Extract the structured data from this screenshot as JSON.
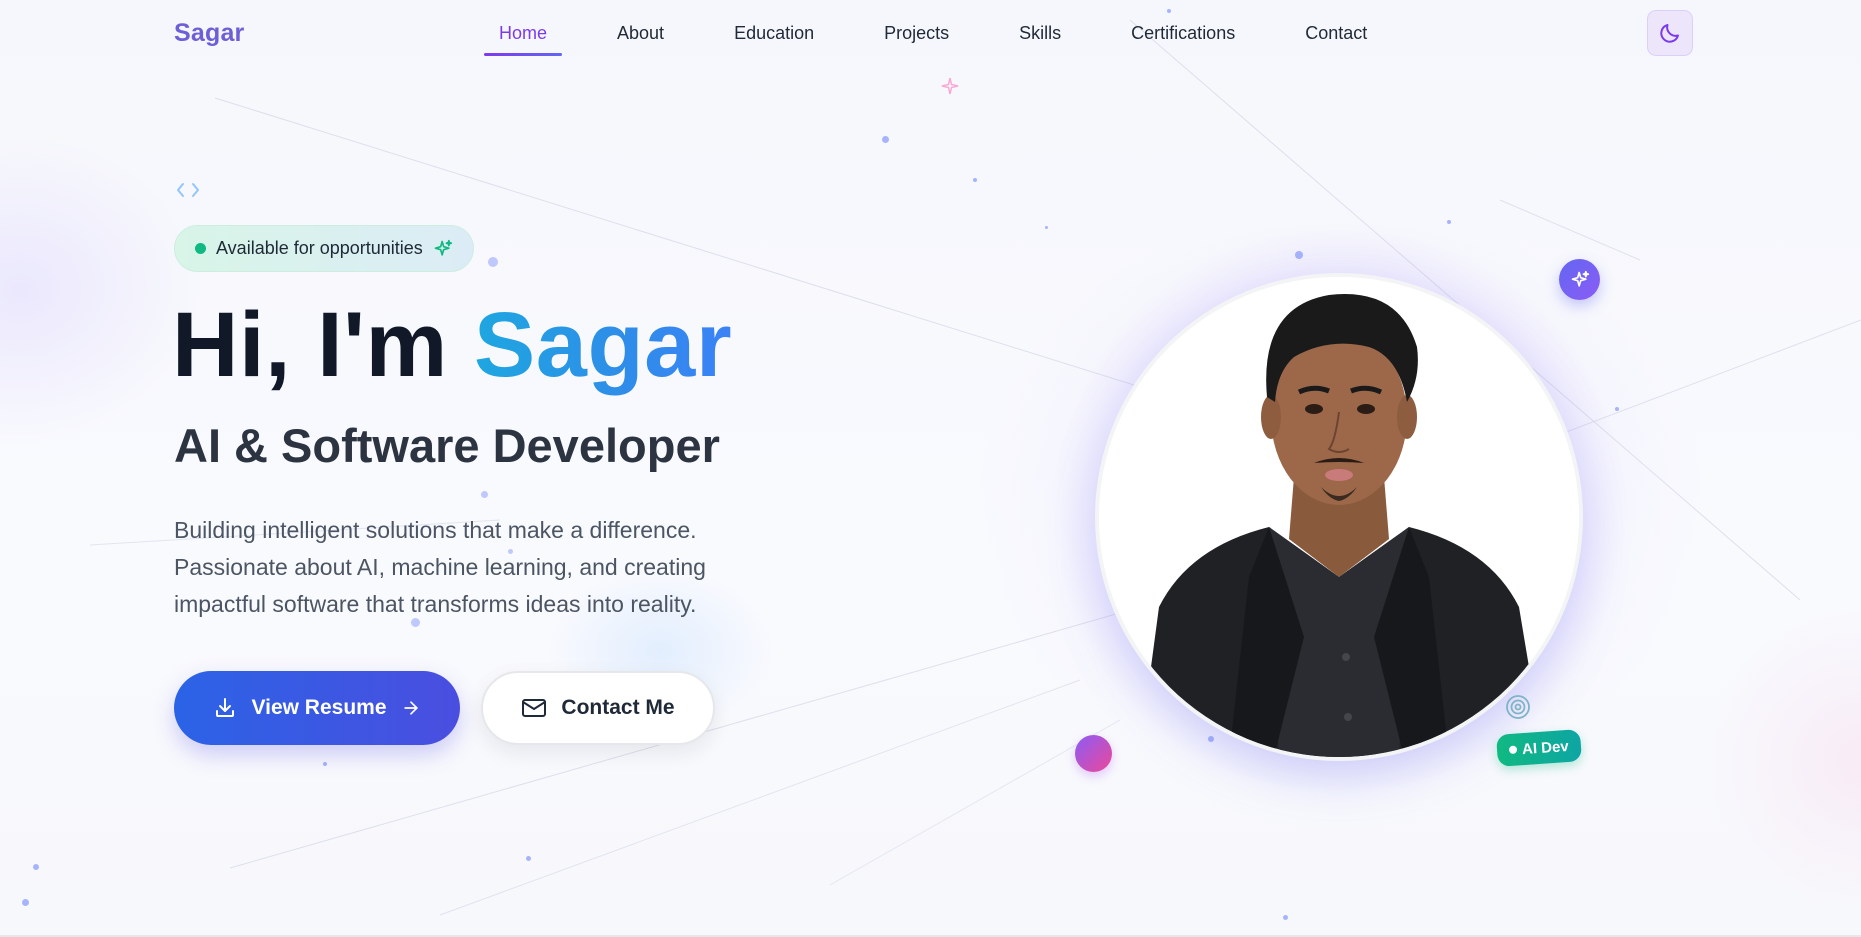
{
  "nav": {
    "logo": "Sagar",
    "links": [
      {
        "label": "Home",
        "active": true
      },
      {
        "label": "About",
        "active": false
      },
      {
        "label": "Education",
        "active": false
      },
      {
        "label": "Projects",
        "active": false
      },
      {
        "label": "Skills",
        "active": false
      },
      {
        "label": "Certifications",
        "active": false
      },
      {
        "label": "Contact",
        "active": false
      }
    ],
    "theme_toggle_icon": "moon-icon"
  },
  "hero": {
    "code_icon": "code-icon",
    "status": "Available for opportunities",
    "status_icon": "sparkles-icon",
    "greeting": "Hi, I'm ",
    "name": "Sagar",
    "subtitle": "AI & Software Developer",
    "description": "Building intelligent solutions that make a difference. Passionate about AI, machine learning, and creating impactful software that transforms ideas into reality.",
    "primary_button": {
      "label": "View Resume",
      "icon": "download-icon",
      "trailing_icon": "arrow-right-icon"
    },
    "secondary_button": {
      "label": "Contact Me",
      "icon": "mail-icon"
    }
  },
  "portrait": {
    "image": "profile-photo",
    "badge_icon": "sparkles-icon",
    "tag": "AI Dev",
    "target_icon": "target-icon"
  },
  "colors": {
    "accent_purple": "#7c3aed",
    "logo": "#6d5fd6",
    "name_gradient_start": "#1ea7e0",
    "name_gradient_end": "#3b82f6",
    "primary_button_start": "#2b63e6",
    "primary_button_end": "#4a4ee0",
    "status_green": "#10b981"
  }
}
